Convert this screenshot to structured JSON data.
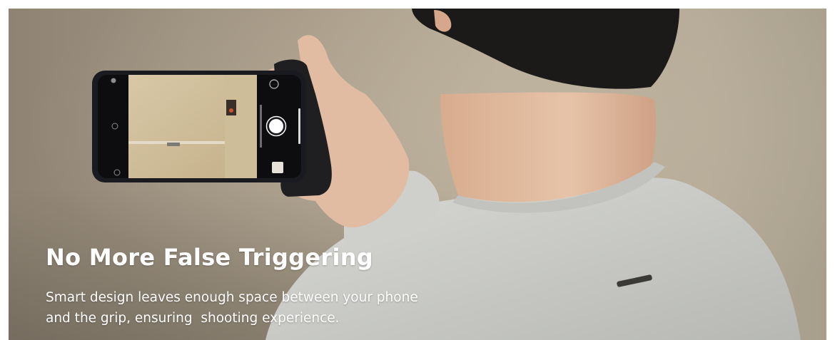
{
  "banner": {
    "headline": "No More False Triggering",
    "description_lines": [
      "Smart design leaves enough space between your phone",
      "and the grip, ensuring  shooting experience."
    ]
  },
  "colors": {
    "background_wall": "#b6ab97",
    "text": "#ffffff",
    "sweater": "#c9cac7",
    "skin": "#e2bca2",
    "hair": "#1c1a18",
    "grip": "#1f1f22"
  }
}
